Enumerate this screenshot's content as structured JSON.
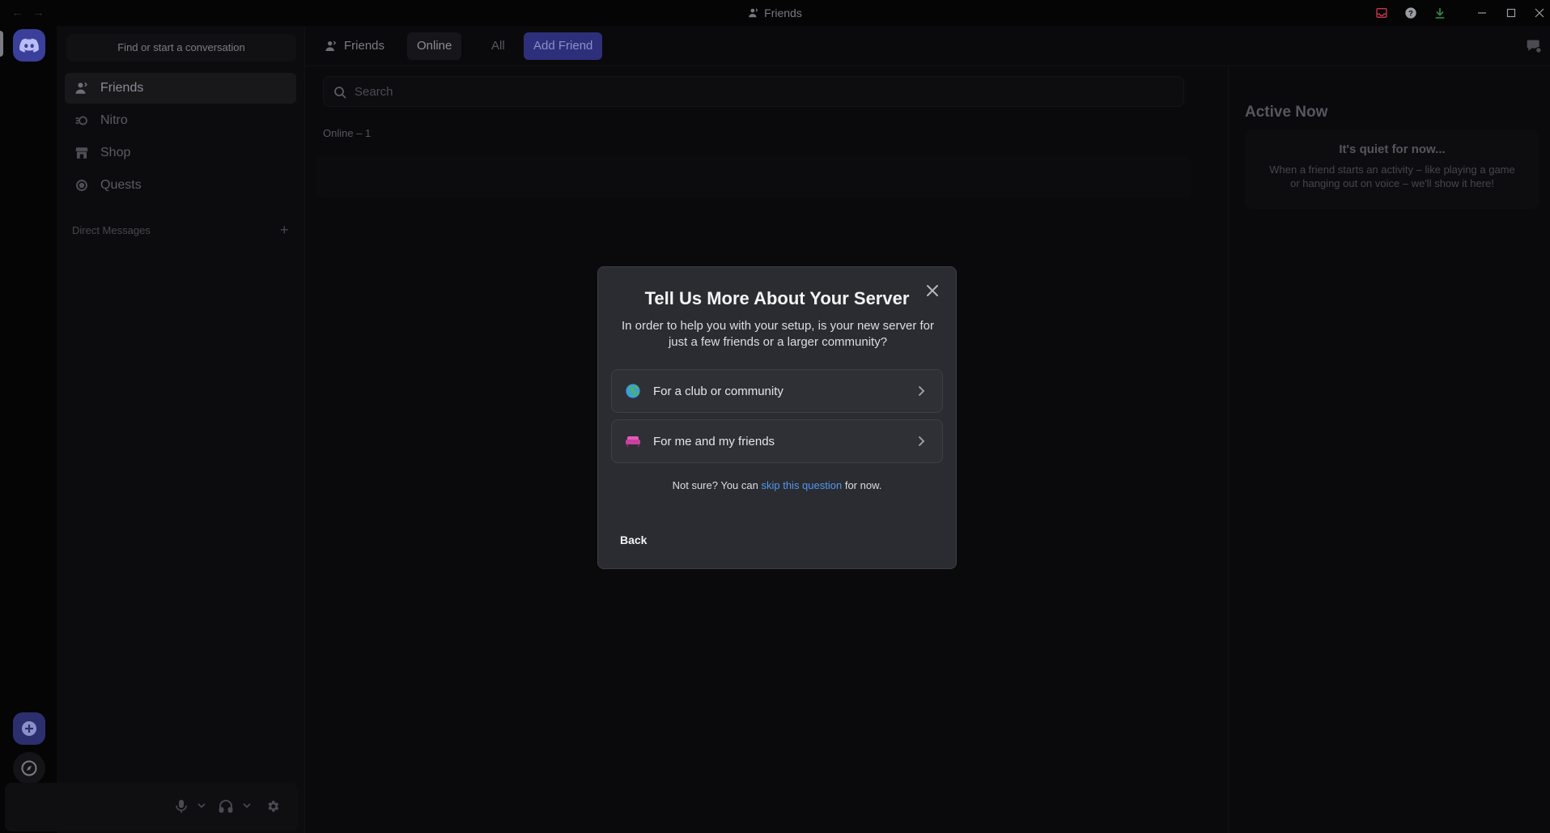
{
  "window": {
    "title": "Friends",
    "back_arrow": "←",
    "forward_arrow": "→"
  },
  "sidebar": {
    "search_placeholder": "Find or start a conversation",
    "items": [
      {
        "label": "Friends",
        "icon": "friends-icon"
      },
      {
        "label": "Nitro",
        "icon": "nitro-icon"
      },
      {
        "label": "Shop",
        "icon": "shop-icon"
      },
      {
        "label": "Quests",
        "icon": "quests-icon"
      }
    ],
    "dm_header": "Direct Messages",
    "dm_add": "+"
  },
  "topbar": {
    "friends_label": "Friends",
    "tabs": [
      {
        "label": "Online",
        "selected": true
      },
      {
        "label": "All",
        "selected": false
      }
    ],
    "add_friend_label": "Add Friend"
  },
  "friends": {
    "search_placeholder": "Search",
    "online_count_label": "Online – 1"
  },
  "active_now": {
    "title": "Active Now",
    "empty_title": "It's quiet for now...",
    "empty_text": "When a friend starts an activity – like playing a game or hanging out on voice – we'll show it here!"
  },
  "modal": {
    "title": "Tell Us More About Your Server",
    "subtitle": "In order to help you with your setup, is your new server for just a few friends or a larger community?",
    "options": [
      {
        "label": "For a club or community",
        "icon": "globe-icon"
      },
      {
        "label": "For me and my friends",
        "icon": "couch-icon"
      }
    ],
    "note_prefix": "Not sure? You can",
    "note_link": "skip this question",
    "note_suffix": "for now.",
    "back_label": "Back"
  },
  "colors": {
    "brand": "#5865f2",
    "link": "#5197ed",
    "modal_bg": "#2b2c31"
  }
}
